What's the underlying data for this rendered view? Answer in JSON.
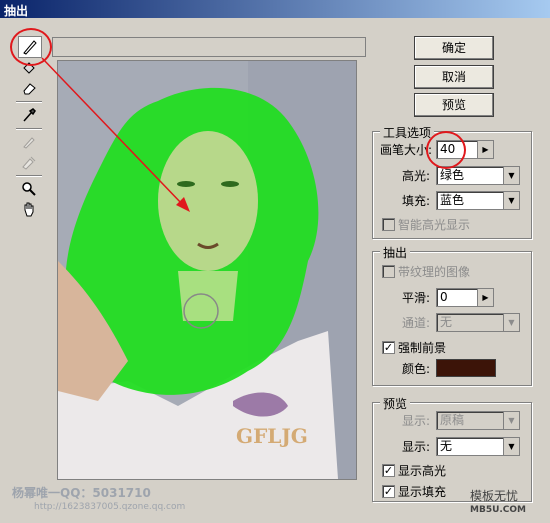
{
  "window": {
    "title": "抽出"
  },
  "toolbox": {
    "tools": [
      {
        "icon": "edge-highlighter-icon"
      },
      {
        "icon": "fill-bucket-icon"
      },
      {
        "icon": "eraser-icon"
      },
      {
        "icon": "eyedropper-icon"
      },
      {
        "icon": "cleanup-tool-icon"
      },
      {
        "icon": "edge-touchup-icon"
      },
      {
        "icon": "zoom-icon"
      },
      {
        "icon": "hand-icon"
      }
    ]
  },
  "buttons": {
    "ok": "确定",
    "cancel": "取消",
    "preview": "预览"
  },
  "tool_options": {
    "legend": "工具选项",
    "brush_size_label": "画笔大小:",
    "brush_size_value": "40",
    "highlight_label": "高光:",
    "highlight_value": "绿色",
    "fill_label": "填充:",
    "fill_value": "蓝色",
    "smart_highlight_label": "智能高光显示"
  },
  "extraction": {
    "legend": "抽出",
    "textured_label": "带纹理的图像",
    "smooth_label": "平滑:",
    "smooth_value": "0",
    "channel_label": "通道:",
    "channel_value": "无",
    "force_fg_label": "强制前景",
    "color_label": "颜色:",
    "color_hex": "#3c1408"
  },
  "preview_group": {
    "legend": "预览",
    "show_label": "显示:",
    "show_value": "原稿",
    "display_label": "显示:",
    "display_value": "无",
    "show_highlight_label": "显示高光",
    "show_fill_label": "显示填充"
  },
  "watermarks": {
    "left_text": "杨幂唯一QQ：5031710",
    "left_url": "http://1623837005.qzone.qq.com",
    "right_text": "模板无忧",
    "right_url": "MB5U.COM",
    "logo_text": "GFLJG"
  },
  "colors": {
    "highlight": "#22dd22",
    "annotation": "#e0181c"
  }
}
